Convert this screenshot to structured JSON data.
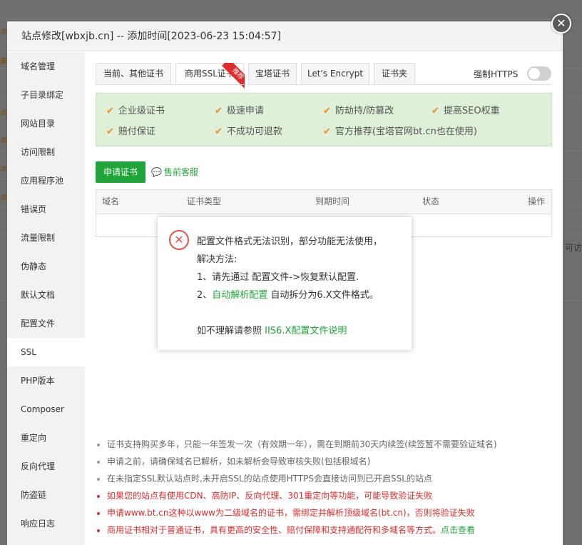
{
  "background": {
    "fragments_left": [
      "点",
      "备",
      "点",
      "点",
      "点",
      "点"
    ],
    "fragment_right": "可访"
  },
  "dialog": {
    "title": "站点修改[wbxjb.cn] -- 添加时间[2023-06-23 15:04:57]",
    "close_glyph": "✕"
  },
  "sidebar": {
    "items": [
      {
        "label": "域名管理"
      },
      {
        "label": "子目录绑定"
      },
      {
        "label": "网站目录"
      },
      {
        "label": "访问限制"
      },
      {
        "label": "应用程序池"
      },
      {
        "label": "错误页"
      },
      {
        "label": "流量限制"
      },
      {
        "label": "伪静态"
      },
      {
        "label": "默认文档"
      },
      {
        "label": "配置文件"
      },
      {
        "label": "SSL"
      },
      {
        "label": "PHP版本"
      },
      {
        "label": "Composer"
      },
      {
        "label": "重定向"
      },
      {
        "label": "反向代理"
      },
      {
        "label": "防盗链"
      },
      {
        "label": "响应日志"
      }
    ],
    "active_index": 10
  },
  "tabs": [
    {
      "label": "当前、其他证书"
    },
    {
      "label": "商用SSL证书",
      "badge": "推荐"
    },
    {
      "label": "宝塔证书"
    },
    {
      "label": "Let's Encrypt"
    },
    {
      "label": "证书夹"
    }
  ],
  "force_https": {
    "label": "强制HTTPS",
    "enabled": false
  },
  "features": [
    "企业级证书",
    "极速申请",
    "防劫持/防篡改",
    "提高SEO权重",
    "赔付保证",
    "不成功可退款",
    "官方推荐(宝塔官网bt.cn也在使用)"
  ],
  "check_glyph": "✔",
  "apply_button": "申请证书",
  "presale_link": "售前客服",
  "presale_icon_glyph": "💬",
  "table": {
    "headers": [
      "域名",
      "证书类型",
      "到期时间",
      "状态",
      "操作"
    ]
  },
  "notes": [
    {
      "text": "证书支持购买多年，只能一年签发一次（有效期一年），需在到期前30天内续签(续签暂不需要验证域名)",
      "red": false
    },
    {
      "text": "申请之前，请确保域名已解析，如未解析会导致审核失败(包括根域名)",
      "red": false
    },
    {
      "text": "在未指定SSL默认站点时,未开启SSL的站点使用HTTPS会直接访问到已开启SSL的站点",
      "red": false
    },
    {
      "text": "如果您的站点有使用CDN、高防IP、反向代理、301重定向等功能，可能导致验证失败",
      "red": true
    },
    {
      "text": "申请www.bt.cn这种以www为二级域名的证书，需绑定并解析顶级域名(bt.cn)，否则将验证失败",
      "red": true
    },
    {
      "text": "商用证书相对于普通证书，具有更高的安全性、赔付保障和支持通配符和多域名等方式。",
      "red": true,
      "link": "点击查看"
    }
  ],
  "alert": {
    "icon_glyph": "✕",
    "line1": "配置文件格式无法识别，部分功能无法使用，",
    "line2": "解决方法:",
    "line3": "1、请先通过 配置文件->恢复默认配置.",
    "line4_prefix": "2、",
    "line4_link": "自动解析配置",
    "line4_suffix": " 自动拆分为6.X文件格式。",
    "line5_prefix": "如不理解请参照 ",
    "line5_link": "IIS6.X配置文件说明"
  }
}
